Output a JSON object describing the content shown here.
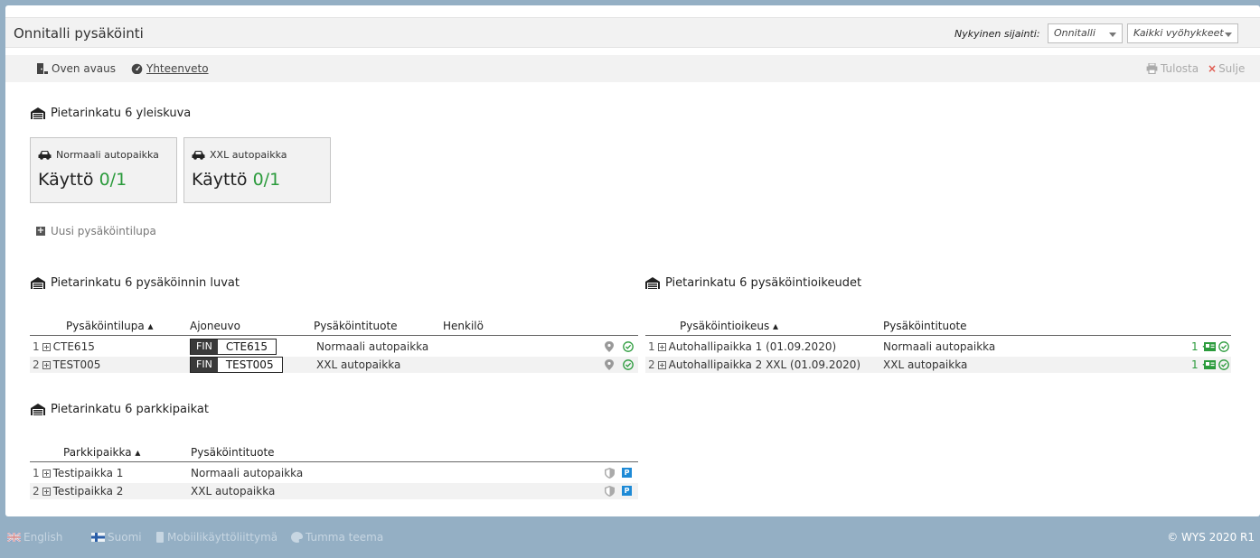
{
  "header": {
    "title": "Onnitalli pysäköinti",
    "location_label": "Nykyinen sijainti:",
    "location_value": "Onnitalli",
    "zone_value": "Kaikki vyöhykkeet"
  },
  "toolbar": {
    "door_open": "Oven avaus",
    "summary": "Yhteenveto",
    "print": "Tulosta",
    "close": "Sulje"
  },
  "overview": {
    "title": "Pietarinkatu 6 yleiskuva",
    "cards": [
      {
        "title": "Normaali autopaikka",
        "prefix": "Käyttö",
        "usage": "0/1"
      },
      {
        "title": "XXL autopaikka",
        "prefix": "Käyttö",
        "usage": "0/1"
      }
    ],
    "new_permit": "Uusi pysäköintilupa"
  },
  "permits": {
    "title": "Pietarinkatu 6 pysäköinnin luvat",
    "columns": [
      "Pysäköintilupa",
      "Ajoneuvo",
      "Pysäköintituote",
      "Henkilö"
    ],
    "rows": [
      {
        "num": "1",
        "permit": "CTE615",
        "country": "FIN",
        "plate": "CTE615",
        "product": "Normaali autopaikka",
        "person": ""
      },
      {
        "num": "2",
        "permit": "TEST005",
        "country": "FIN",
        "plate": "TEST005",
        "product": "XXL autopaikka",
        "person": ""
      }
    ]
  },
  "rights": {
    "title": "Pietarinkatu 6 pysäköintioikeudet",
    "columns": [
      "Pysäköintioikeus",
      "Pysäköintituote"
    ],
    "rows": [
      {
        "num": "1",
        "right": "Autohallipaikka 1 (01.09.2020)",
        "product": "Normaali autopaikka",
        "count": "1"
      },
      {
        "num": "2",
        "right": "Autohallipaikka 2 XXL (01.09.2020)",
        "product": "XXL autopaikka",
        "count": "1"
      }
    ]
  },
  "spots": {
    "title": "Pietarinkatu 6 parkkipaikat",
    "columns": [
      "Parkkipaikka",
      "Pysäköintituote"
    ],
    "rows": [
      {
        "num": "1",
        "spot": "Testipaikka 1",
        "product": "Normaali autopaikka"
      },
      {
        "num": "2",
        "spot": "Testipaikka 2",
        "product": "XXL autopaikka"
      }
    ]
  },
  "footer": {
    "english": "English",
    "finnish": "Suomi",
    "mobile": "Mobiilikäyttöliittymä",
    "dark": "Tumma teema",
    "copyright": "© WYS 2020 R1"
  },
  "colors": {
    "accent_green": "#2b9b3c",
    "footer_bg": "#94afc4",
    "badge_blue": "#1e8ad6"
  }
}
